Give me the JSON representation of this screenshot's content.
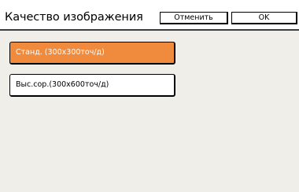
{
  "header": {
    "title": "Качество изображения",
    "cancel_label": "Отменить",
    "ok_label": "OK"
  },
  "options": [
    {
      "label": "Станд. (300x300точ/д)",
      "selected": true
    },
    {
      "label": "Выс.сор.(300x600точ/д)",
      "selected": false
    }
  ],
  "colors": {
    "selected": "#f08a3c",
    "panel_background": "#efeee9"
  }
}
